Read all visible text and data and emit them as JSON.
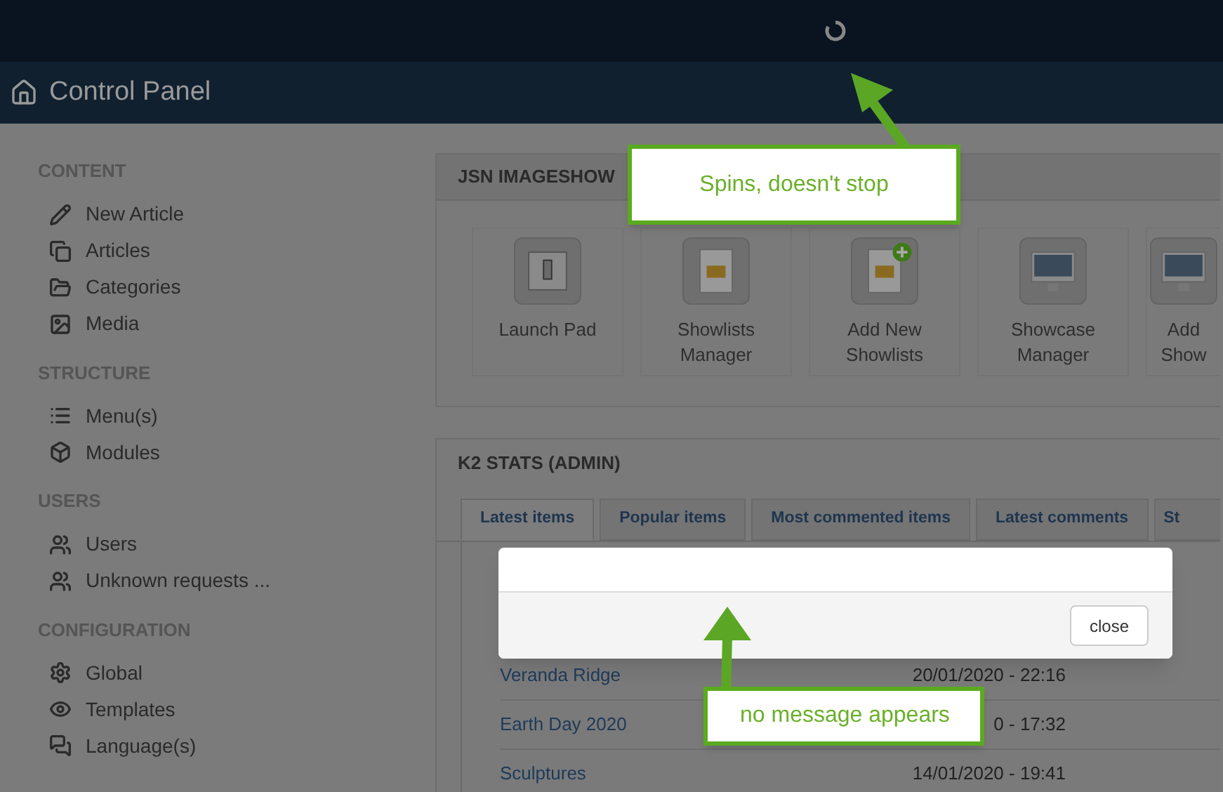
{
  "header": {
    "title": "Control Panel"
  },
  "sidebar": [
    {
      "heading": "CONTENT",
      "items": [
        "New Article",
        "Articles",
        "Categories",
        "Media"
      ]
    },
    {
      "heading": "STRUCTURE",
      "items": [
        "Menu(s)",
        "Modules"
      ]
    },
    {
      "heading": "USERS",
      "items": [
        "Users",
        "Unknown requests ..."
      ]
    },
    {
      "heading": "CONFIGURATION",
      "items": [
        "Global",
        "Templates",
        "Language(s)"
      ]
    }
  ],
  "imageshow_panel": {
    "title": "JSN IMAGESHOW",
    "tiles": [
      {
        "kind": "switch",
        "label": [
          "Launch Pad"
        ]
      },
      {
        "kind": "document",
        "label": [
          "Showlists",
          "Manager"
        ]
      },
      {
        "kind": "document-add",
        "label": [
          "Add New",
          "Showlists"
        ]
      },
      {
        "kind": "monitor",
        "label": [
          "Showcase",
          "Manager"
        ]
      },
      {
        "kind": "monitor",
        "label": [
          "Add",
          "Show"
        ]
      }
    ]
  },
  "k2_panel": {
    "title": "K2 STATS (ADMIN)",
    "tabs": [
      {
        "label": "Latest items",
        "selected": true
      },
      {
        "label": "Popular items",
        "selected": false
      },
      {
        "label": "Most commented items",
        "selected": false
      },
      {
        "label": "Latest comments",
        "selected": false
      },
      {
        "label": "St",
        "selected": false
      }
    ],
    "rows": [
      {
        "title": "Veranda Ridge",
        "date": "20/01/2020 - 22:16"
      },
      {
        "title": "Earth Day 2020",
        "date": "0 - 17:32"
      },
      {
        "title": "Sculptures",
        "date": "14/01/2020 - 19:41"
      }
    ]
  },
  "modal": {
    "button": "close"
  },
  "annotations": [
    "Spins, doesn't stop",
    "no message appears"
  ]
}
